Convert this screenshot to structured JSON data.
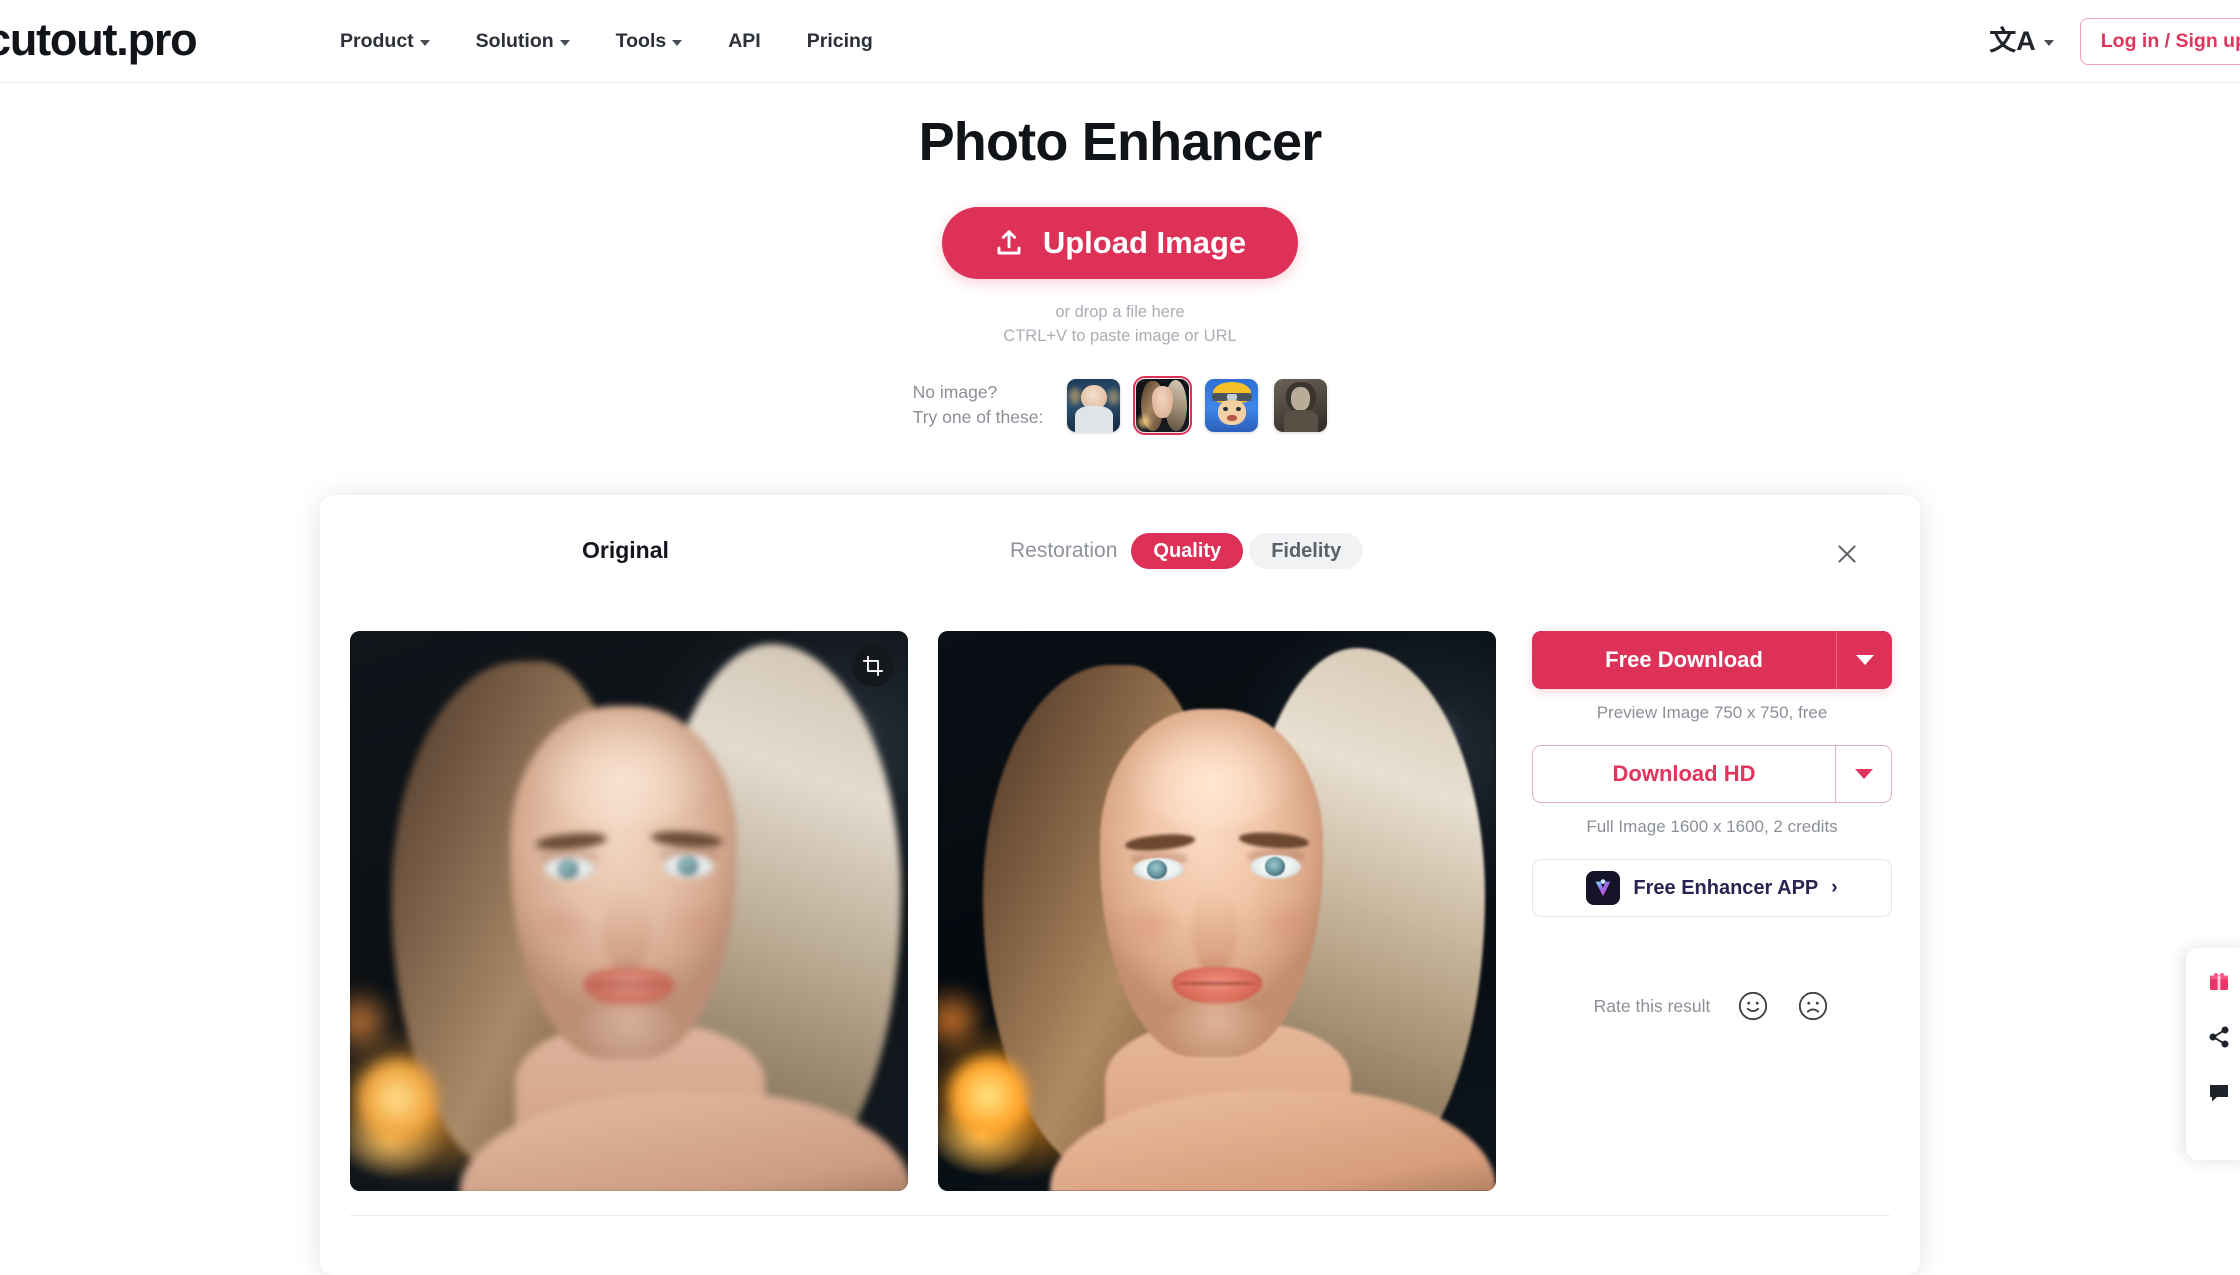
{
  "header": {
    "logo": "cutout.pro",
    "nav": [
      {
        "label": "Product",
        "has_caret": true
      },
      {
        "label": "Solution",
        "has_caret": true
      },
      {
        "label": "Tools",
        "has_caret": true
      },
      {
        "label": "API",
        "has_caret": false
      },
      {
        "label": "Pricing",
        "has_caret": false
      }
    ],
    "lang_glyph": "文A",
    "login_label": "Log in / Sign up"
  },
  "hero": {
    "title": "Photo Enhancer",
    "upload_label": "Upload Image",
    "drop_line1": "or drop a file here",
    "drop_line2": "CTRL+V to paste image or URL",
    "samples_line1": "No image?",
    "samples_line2": "Try one of these:",
    "samples": [
      {
        "name": "sample-child",
        "selected": false
      },
      {
        "name": "sample-woman-portrait",
        "selected": true
      },
      {
        "name": "sample-anime-naruto",
        "selected": false
      },
      {
        "name": "sample-vintage-woman",
        "selected": false
      }
    ]
  },
  "card": {
    "original_label": "Original",
    "mode_label": "Restoration",
    "mode_quality": "Quality",
    "mode_fidelity": "Fidelity",
    "active_mode": "Quality",
    "close_icon": "close-icon",
    "crop_icon": "crop-icon"
  },
  "actions": {
    "free_download_label": "Free Download",
    "free_download_hint": "Preview Image 750 x 750, free",
    "download_hd_label": "Download HD",
    "download_hd_hint": "Full Image 1600 x 1600, 2 credits",
    "app_label": "Free Enhancer APP",
    "app_chevron": "›",
    "rate_label": "Rate this result",
    "rate_positive_icon": "smiley-happy-icon",
    "rate_negative_icon": "smiley-sad-icon"
  },
  "side_widget": {
    "items": [
      {
        "name": "gift-icon"
      },
      {
        "name": "share-icon"
      },
      {
        "name": "feedback-icon"
      }
    ]
  },
  "colors": {
    "accent": "#dd3158",
    "accent_text": "#e2345c",
    "accent_border": "#e9aebc",
    "text_primary": "#13171d",
    "text_muted": "#8b9098",
    "pill_inactive_bg": "#f1f2f3",
    "app_icon_bg": "#151327"
  }
}
